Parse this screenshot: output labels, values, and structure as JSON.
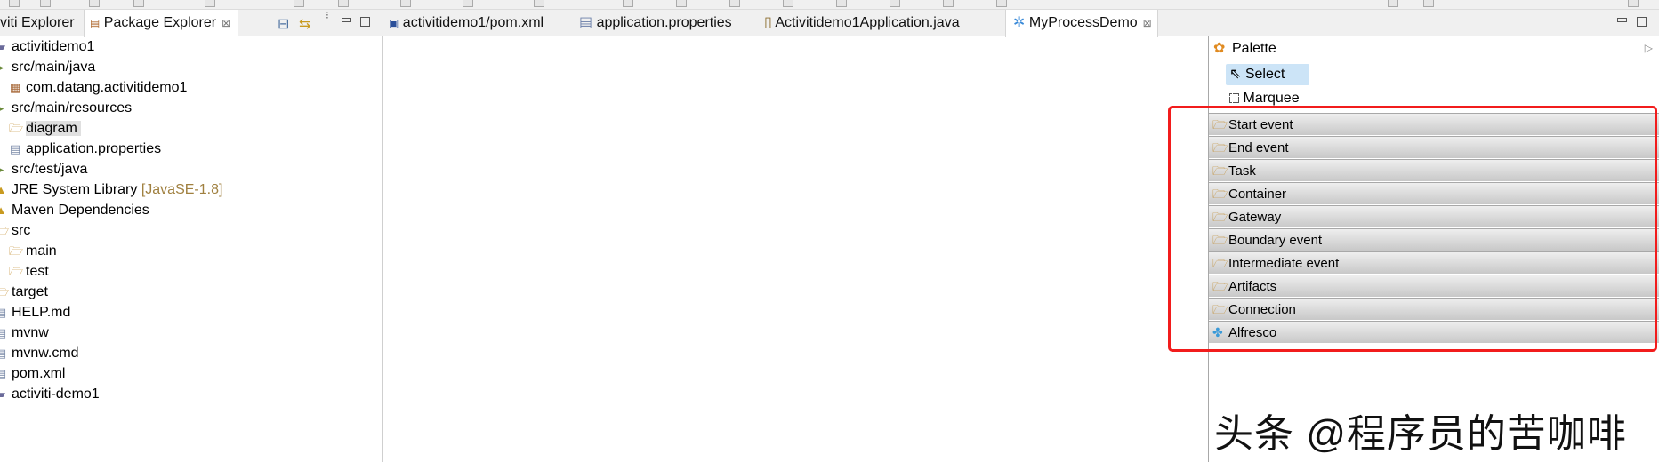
{
  "left_tabs": [
    {
      "label": "viti Explorer",
      "active": false
    },
    {
      "label": "Package Explorer",
      "active": true
    }
  ],
  "tree": [
    {
      "label": "activitidemo1",
      "icon": "project",
      "indent": 0
    },
    {
      "label": "src/main/java",
      "icon": "source-folder",
      "indent": 0
    },
    {
      "label": "com.datang.activitidemo1",
      "icon": "package",
      "indent": 1
    },
    {
      "label": "src/main/resources",
      "icon": "source-folder",
      "indent": 0
    },
    {
      "label": "diagram",
      "icon": "folder",
      "indent": 1,
      "selected": true
    },
    {
      "label": "application.properties",
      "icon": "file",
      "indent": 1
    },
    {
      "label": "src/test/java",
      "icon": "source-folder",
      "indent": 0
    },
    {
      "label": "JRE System Library",
      "decoration": "[JavaSE-1.8]",
      "icon": "library",
      "indent": 0
    },
    {
      "label": "Maven Dependencies",
      "icon": "library",
      "indent": 0
    },
    {
      "label": "src",
      "icon": "folder",
      "indent": 0
    },
    {
      "label": "main",
      "icon": "folder",
      "indent": 1
    },
    {
      "label": "test",
      "icon": "folder",
      "indent": 1
    },
    {
      "label": "target",
      "icon": "folder",
      "indent": 0
    },
    {
      "label": "HELP.md",
      "icon": "file",
      "indent": 0
    },
    {
      "label": "mvnw",
      "icon": "file",
      "indent": 0
    },
    {
      "label": "mvnw.cmd",
      "icon": "file",
      "indent": 0
    },
    {
      "label": "pom.xml",
      "icon": "file",
      "indent": 0
    },
    {
      "label": "activiti-demo1",
      "icon": "project",
      "indent": 0
    }
  ],
  "editor_tabs": [
    {
      "label": "activitidemo1/pom.xml",
      "icon": "maven-file-icon"
    },
    {
      "label": "application.properties",
      "icon": "properties-file-icon"
    },
    {
      "label": "Activitidemo1Application.java",
      "icon": "java-file-icon"
    },
    {
      "label": "MyProcessDemo",
      "icon": "process-icon",
      "active": true
    }
  ],
  "palette": {
    "title": "Palette",
    "tools": [
      {
        "label": "Select",
        "selected": true
      },
      {
        "label": "Marquee"
      }
    ],
    "drawers": [
      "Start event",
      "End event",
      "Task",
      "Container",
      "Gateway",
      "Boundary event",
      "Intermediate event",
      "Artifacts",
      "Connection",
      "Alfresco"
    ]
  },
  "watermark": "头条 @程序员的苦咖啡",
  "colors": {
    "highlight": "#f21c1c",
    "selection": "#cce4f7"
  }
}
